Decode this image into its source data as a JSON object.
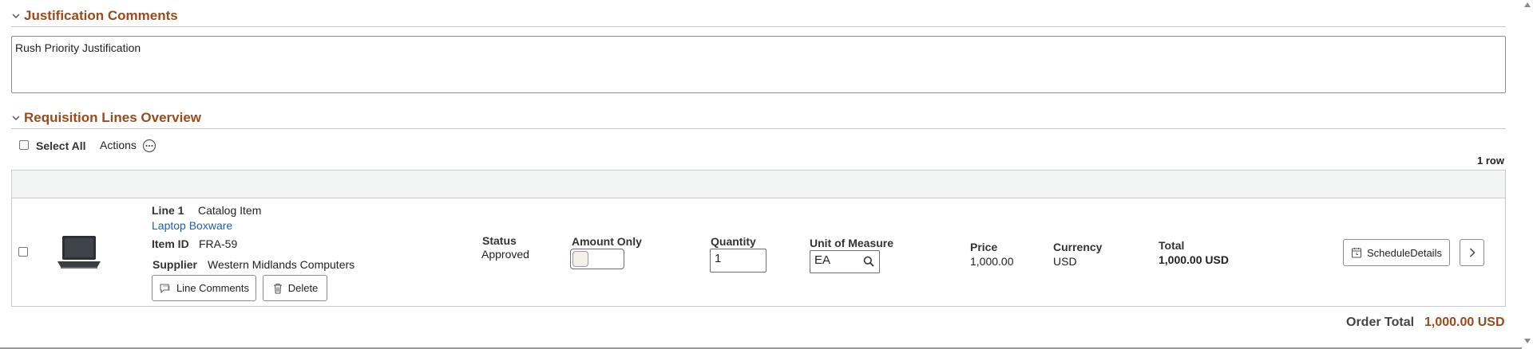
{
  "justification": {
    "title": "Justification Comments",
    "text": "Rush Priority Justification"
  },
  "overview": {
    "title": "Requisition Lines Overview",
    "select_all": "Select All",
    "actions": "Actions",
    "row_count": "1 row"
  },
  "line": {
    "line_label": "Line 1",
    "line_type": "Catalog Item",
    "description": "Laptop Boxware",
    "item_id_label": "Item ID",
    "item_id": "FRA-59",
    "supplier_label": "Supplier",
    "supplier": "Western Midlands Computers",
    "line_comments_btn": "Line Comments",
    "delete_btn": "Delete",
    "status_label": "Status",
    "status": "Approved",
    "amount_only_label": "Amount Only",
    "quantity_label": "Quantity",
    "quantity": "1",
    "uom_label": "Unit of Measure",
    "uom": "EA",
    "price_label": "Price",
    "price": "1,000.00",
    "currency_label": "Currency",
    "currency": "USD",
    "total_label": "Total",
    "total": "1,000.00 USD",
    "schedule_btn": "ScheduleDetails"
  },
  "order_total": {
    "label": "Order Total",
    "value": "1,000.00 USD"
  },
  "colors": {
    "section_title": "#9a4a1b",
    "link": "#2060a8",
    "header_band": "#f3f5f5"
  },
  "icons": [
    "chevron-down-icon",
    "ellipsis-circle-icon",
    "laptop-icon",
    "comment-icon",
    "trash-icon",
    "search-icon",
    "schedule-icon",
    "chevron-right-icon",
    "scroll-arrow-up-icon",
    "scroll-arrow-down-icon"
  ]
}
